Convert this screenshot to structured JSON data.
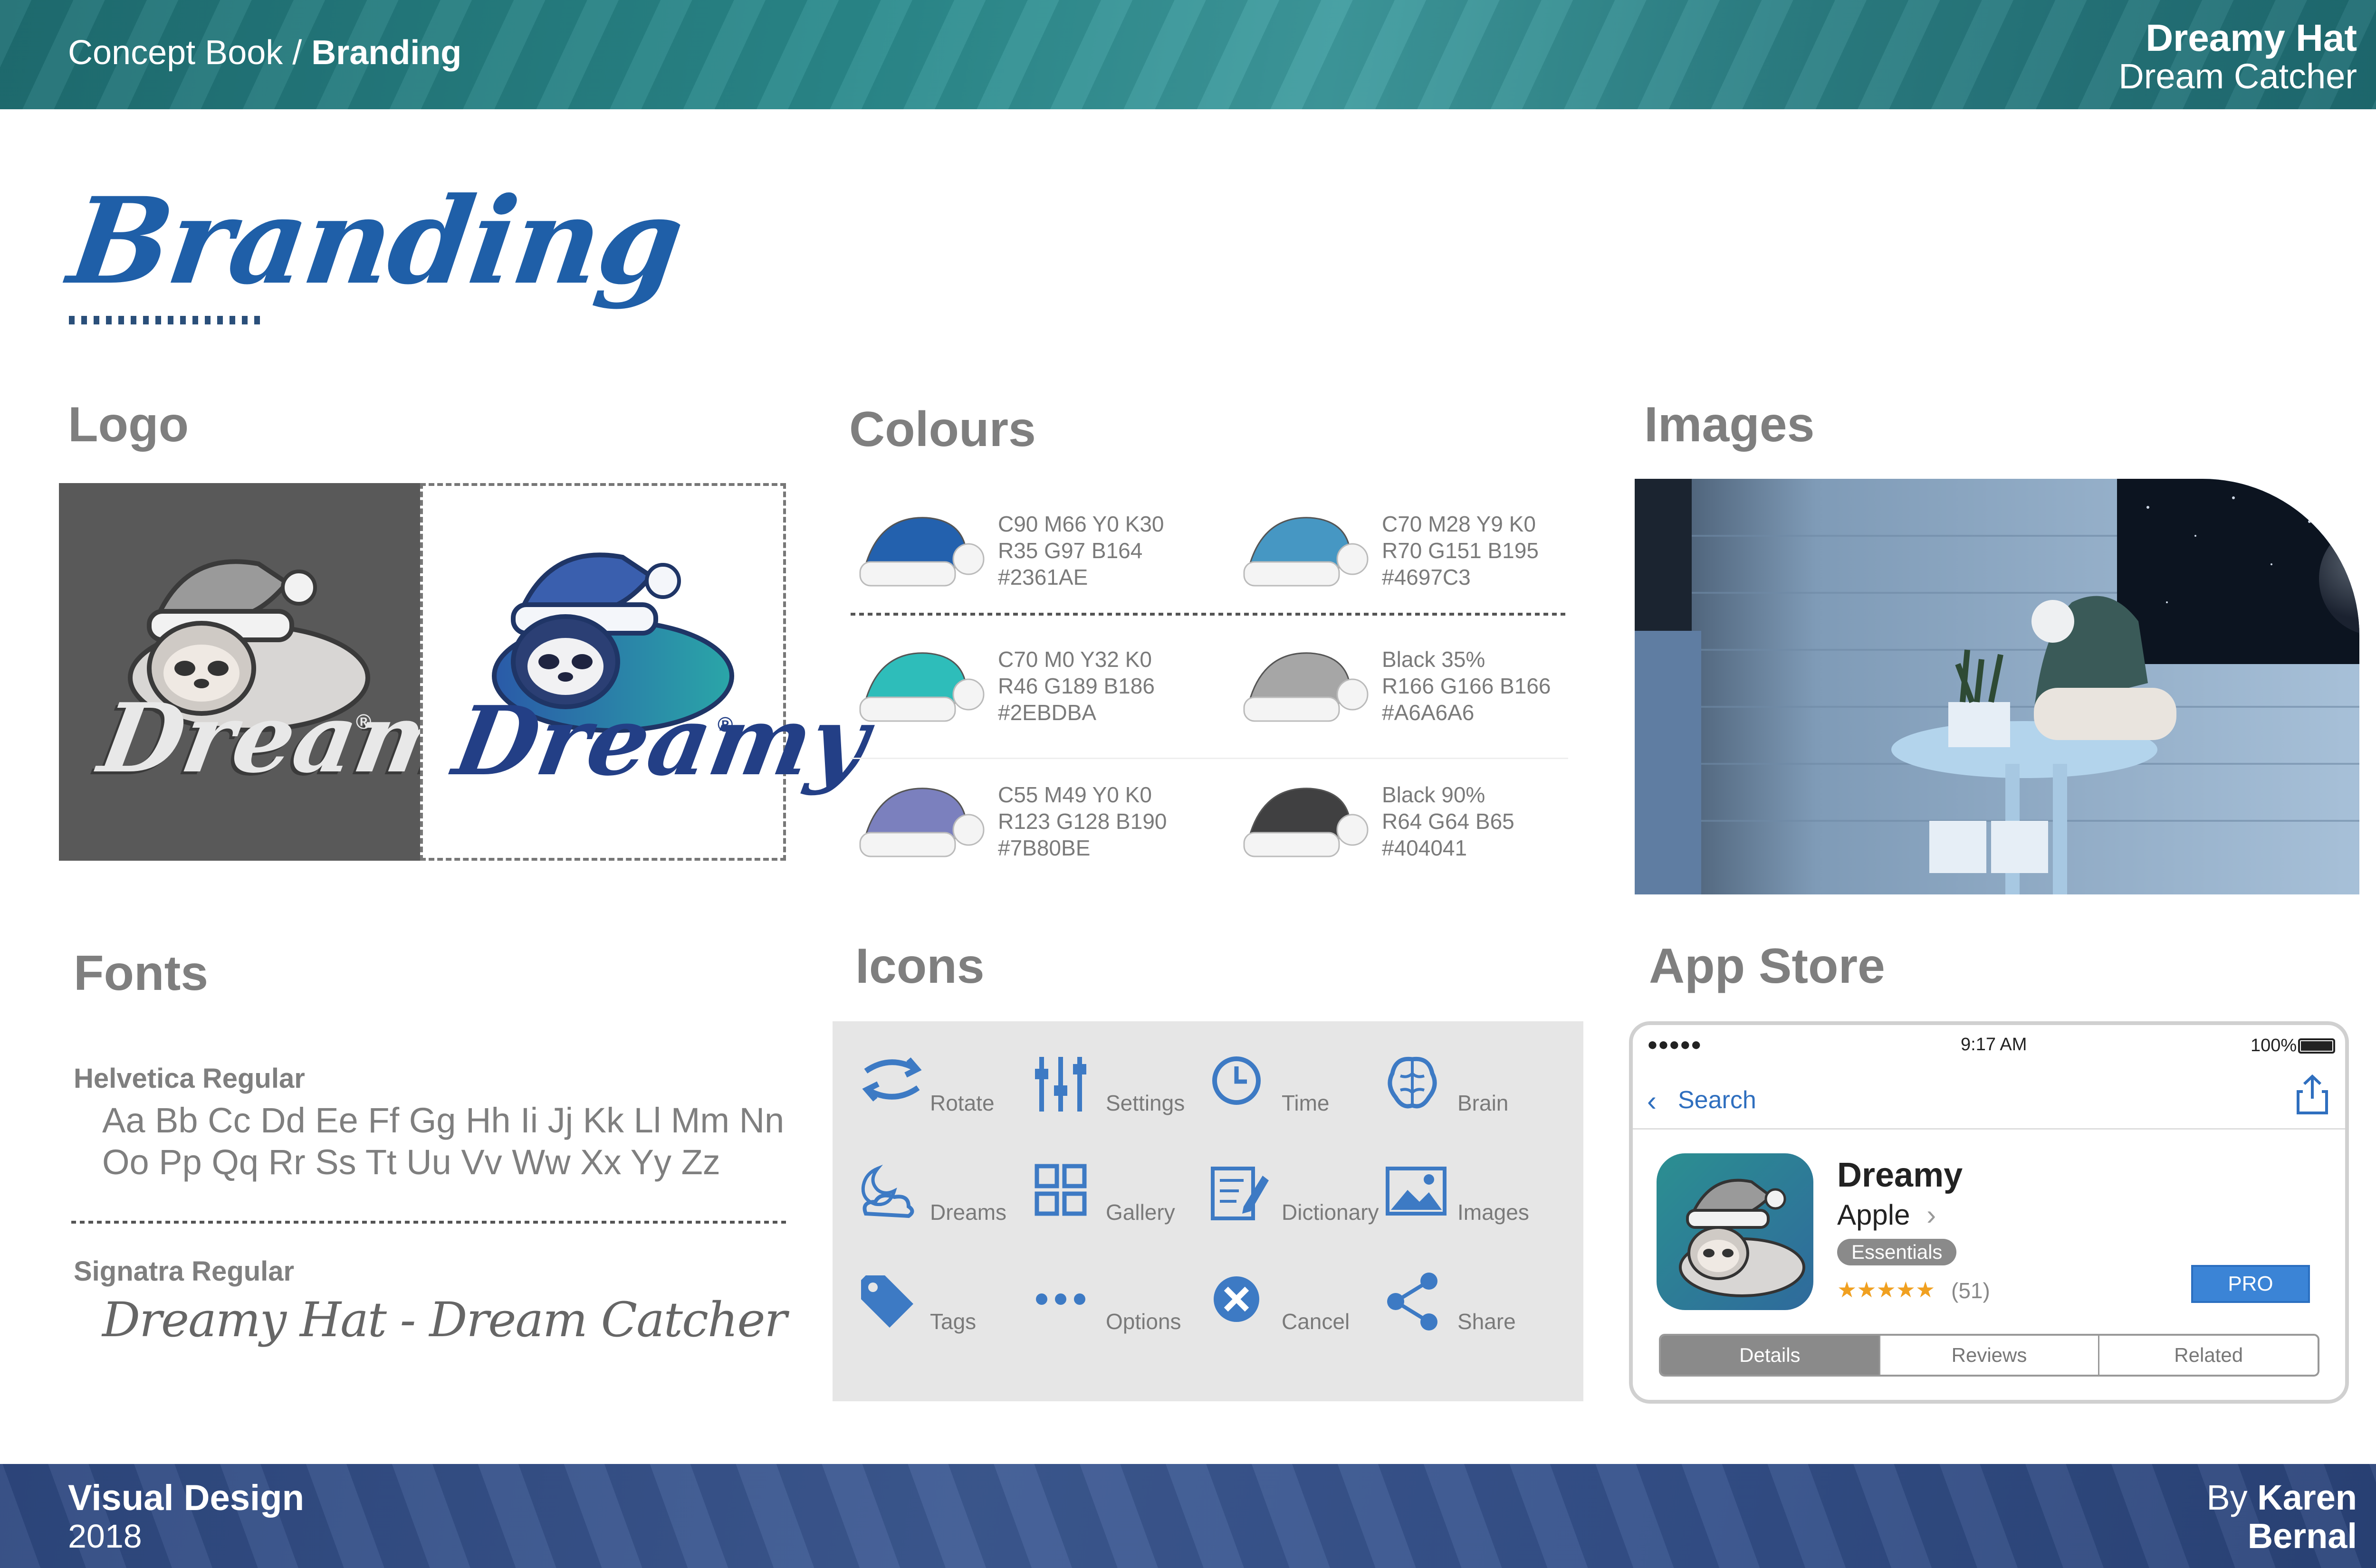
{
  "header": {
    "crumb_parent": "Concept Book / ",
    "crumb_current": "Branding",
    "project_title": "Dreamy Hat",
    "project_subtitle": "Dream Catcher"
  },
  "page_title": "Branding",
  "sections": {
    "logo": "Logo",
    "colours": "Colours",
    "images": "Images",
    "fonts": "Fonts",
    "icons": "Icons",
    "app_store": "App Store"
  },
  "logo": {
    "wordmark": "Dreamy",
    "registered": "®"
  },
  "colours": [
    {
      "cmyk": "C90 M66 Y0 K30",
      "rgb": "R35 G97 B164",
      "hex": "#2361AE",
      "color": "#2361AE"
    },
    {
      "cmyk": "C70 M28 Y9 K0",
      "rgb": "R70 G151 B195",
      "hex": "#4697C3",
      "color": "#4697C3"
    },
    {
      "cmyk": "C70 M0 Y32 K0",
      "rgb": "R46 G189 B186",
      "hex": "#2EBDBA",
      "color": "#2EBDBA"
    },
    {
      "cmyk": "Black 35%",
      "rgb": "R166 G166 B166",
      "hex": "#A6A6A6",
      "color": "#A6A6A6"
    },
    {
      "cmyk": "C55 M49 Y0 K0",
      "rgb": "R123 G128 B190",
      "hex": "#7B80BE",
      "color": "#7B80BE"
    },
    {
      "cmyk": "Black 90%",
      "rgb": "R64 G64 B65",
      "hex": "#404041",
      "color": "#404041"
    }
  ],
  "fonts": {
    "font1_name": "Helvetica Regular",
    "font1_line1": "Aa Bb Cc Dd Ee Ff Gg Hh Ii Jj Kk Ll Mm Nn",
    "font1_line2": "Oo Pp Qq Rr Ss Tt Uu Vv Ww Xx Yy Zz",
    "font2_name": "Signatra Regular",
    "font2_sample": "Dreamy Hat - Dream Catcher"
  },
  "icons": [
    {
      "label": "Rotate",
      "icon": "rotate-icon"
    },
    {
      "label": "Settings",
      "icon": "settings-icon"
    },
    {
      "label": "Time",
      "icon": "clock-icon"
    },
    {
      "label": "Brain",
      "icon": "brain-icon"
    },
    {
      "label": "Dreams",
      "icon": "moon-cloud-icon"
    },
    {
      "label": "Gallery",
      "icon": "grid-icon"
    },
    {
      "label": "Dictionary",
      "icon": "dictionary-icon"
    },
    {
      "label": "Images",
      "icon": "image-icon"
    },
    {
      "label": "Tags",
      "icon": "tag-icon"
    },
    {
      "label": "Options",
      "icon": "more-icon"
    },
    {
      "label": "Cancel",
      "icon": "cancel-icon"
    },
    {
      "label": "Share",
      "icon": "share-icon"
    }
  ],
  "app_store": {
    "signal": "●●●●● ",
    "time": "9:17 AM",
    "battery": "100%",
    "back_label": "Search",
    "app_name": "Dreamy",
    "developer": "Apple",
    "category_badge": "Essentials",
    "stars": "★★★★★",
    "rating_count": "(51)",
    "pro_label": "PRO",
    "tabs": [
      "Details",
      "Reviews",
      "Related"
    ]
  },
  "footer": {
    "left_title": "Visual Design",
    "year": "2018",
    "by": "By ",
    "author_first": "Karen",
    "author_last": "Bernal"
  },
  "accent_color": "#2361AE"
}
